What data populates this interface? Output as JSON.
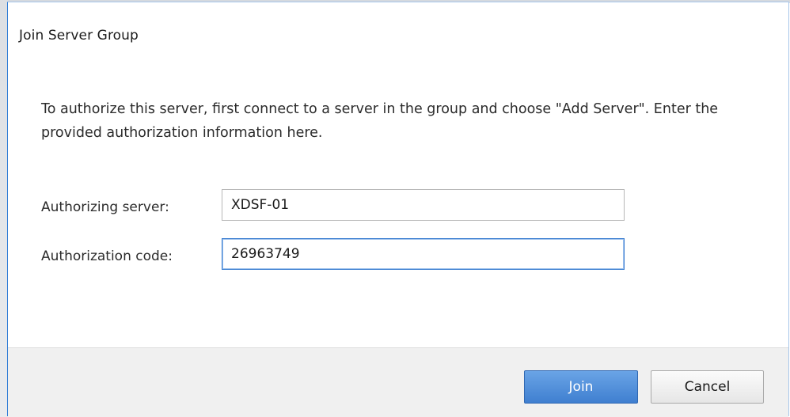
{
  "dialog": {
    "title": "Join Server Group",
    "instructions": "To authorize this server, first connect to a server in the group and choose \"Add Server\". Enter the provided authorization information here.",
    "fields": {
      "authorizing_server": {
        "label": "Authorizing server:",
        "value": "XDSF-01"
      },
      "authorization_code": {
        "label": "Authorization code:",
        "value": "26963749"
      }
    },
    "buttons": {
      "join_label": "Join",
      "cancel_label": "Cancel"
    }
  },
  "colors": {
    "accent": "#3f7fd0",
    "focus_border": "#3d7fd1",
    "footer_background": "#f0f0f0"
  }
}
